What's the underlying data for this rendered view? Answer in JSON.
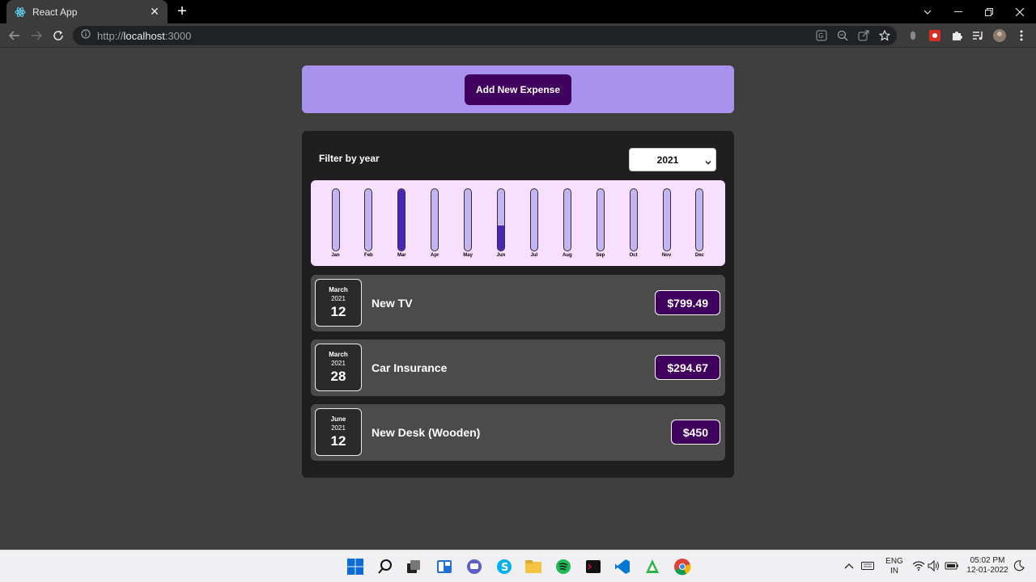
{
  "browser": {
    "tab_title": "React App",
    "url_prefix": "http://",
    "url_host": "localhost",
    "url_port": ":3000"
  },
  "app": {
    "add_button_label": "Add New Expense",
    "filter": {
      "label": "Filter by year",
      "selected_year": "2021"
    },
    "chart_data": {
      "type": "bar",
      "categories": [
        "Jan",
        "Feb",
        "Mar",
        "Apr",
        "May",
        "Jun",
        "Jul",
        "Aug",
        "Sep",
        "Oct",
        "Nov",
        "Dec"
      ],
      "values": [
        0,
        0,
        1094.16,
        0,
        0,
        450,
        0,
        0,
        0,
        0,
        0,
        0
      ],
      "max": 1094.16
    },
    "expenses": [
      {
        "month": "March",
        "year": "2021",
        "day": "12",
        "title": "New TV",
        "amount": "$799.49"
      },
      {
        "month": "March",
        "year": "2021",
        "day": "28",
        "title": "Car Insurance",
        "amount": "$294.67"
      },
      {
        "month": "June",
        "year": "2021",
        "day": "12",
        "title": "New Desk (Wooden)",
        "amount": "$450"
      }
    ]
  },
  "taskbar": {
    "language": "ENG",
    "region": "IN",
    "time": "05:02 PM",
    "date": "12-01-2022"
  }
}
